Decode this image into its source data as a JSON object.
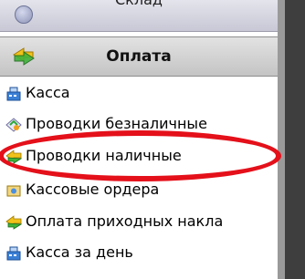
{
  "sidebar": {
    "collapsed_group": {
      "label": "Склад",
      "icon": "warehouse-icon"
    },
    "active_group": {
      "label": "Оплата",
      "icon": "payment-arrows-icon"
    },
    "items": [
      {
        "label": "Касса",
        "icon": "cash-register-icon"
      },
      {
        "label": "Проводки безналичные",
        "icon": "noncash-posting-icon"
      },
      {
        "label": "Проводки наличные",
        "icon": "cash-posting-icon"
      },
      {
        "label": "Кассовые ордера",
        "icon": "cash-orders-icon"
      },
      {
        "label": "Оплата приходных накла",
        "icon": "payment-arrows-icon"
      },
      {
        "label": "Касса за день",
        "icon": "cash-register-icon"
      }
    ]
  },
  "annotation": {
    "highlight_color": "#e4101a",
    "highlighted_item": "Проводки наличные"
  }
}
